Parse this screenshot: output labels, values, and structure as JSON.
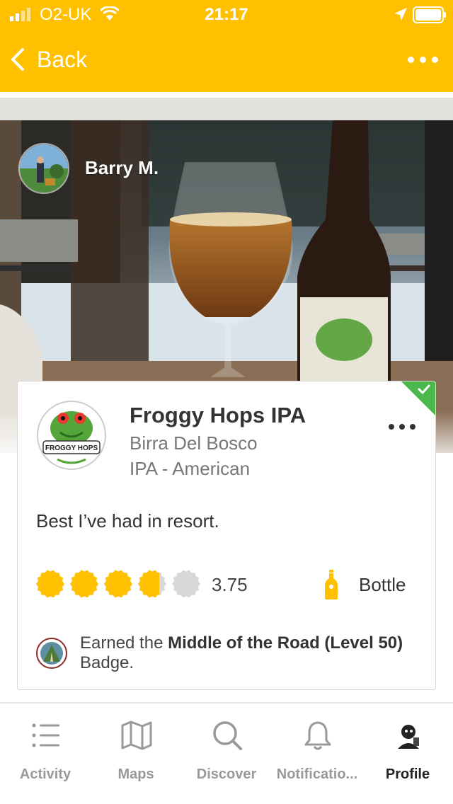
{
  "status_bar": {
    "carrier": "O2-UK",
    "time": "21:17"
  },
  "nav": {
    "back_label": "Back"
  },
  "checkin": {
    "user_name": "Barry M.",
    "beer_name": "Froggy Hops IPA",
    "brewery": "Birra Del Bosco",
    "style": "IPA - American",
    "comment": "Best I’ve had in resort.",
    "rating": 3.75,
    "rating_text": "3.75",
    "rating_max": 5,
    "serving_type": "Bottle",
    "logo_text": "FROGGY HOPS",
    "badge": {
      "prefix": "Earned the ",
      "name": "Middle of the Road (Level 50)",
      "suffix": " Badge."
    }
  },
  "tabs": [
    {
      "label": "Activity",
      "icon": "list-icon"
    },
    {
      "label": "Maps",
      "icon": "map-icon"
    },
    {
      "label": "Discover",
      "icon": "search-icon"
    },
    {
      "label": "Notificatio...",
      "icon": "bell-icon"
    },
    {
      "label": "Profile",
      "icon": "profile-avatar"
    }
  ],
  "colors": {
    "brand": "#FFC000",
    "check_corner": "#4CB84C",
    "rating_cap": "#FFC000",
    "rating_cap_empty": "#D8D8D8"
  }
}
